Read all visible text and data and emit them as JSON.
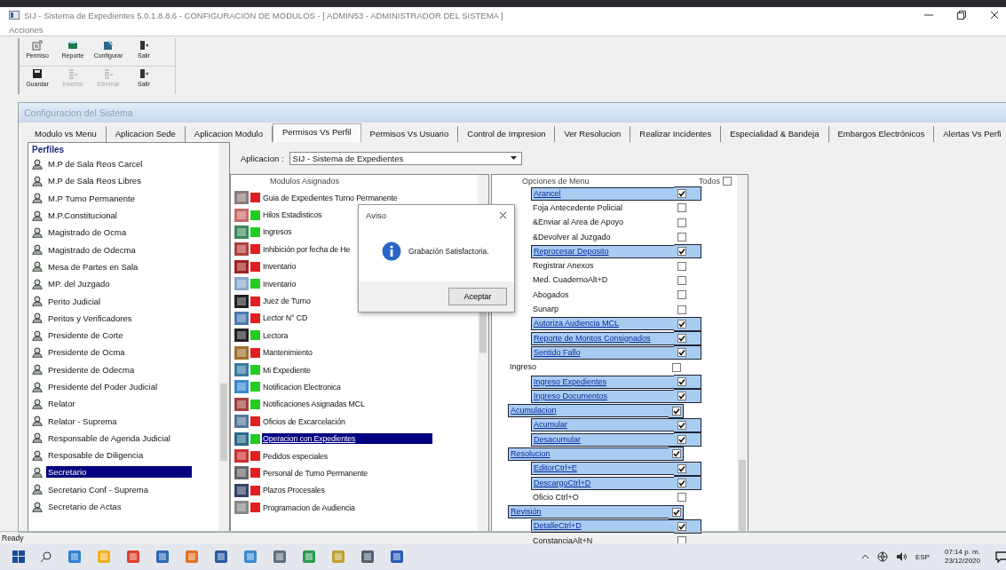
{
  "window": {
    "title": "SIJ - Sistema de Expedientes 5.0.1.8.8.6 - CONFIGURACION DE MODULOS - [ ADMIN53 - ADMINISTRADOR DEL SISTEMA ]"
  },
  "menu": [
    "Acciones"
  ],
  "toolbar_rows": [
    [
      {
        "label": "Permiso",
        "kind": "permiso",
        "disabled": false
      },
      {
        "label": "Reporte",
        "kind": "reporte",
        "disabled": false
      },
      {
        "label": "Configurar",
        "kind": "configurar",
        "disabled": false
      },
      {
        "label": "Salir",
        "kind": "salir",
        "disabled": false
      }
    ],
    [
      {
        "label": "Guardar",
        "kind": "guardar",
        "disabled": false
      },
      {
        "label": "Insertar",
        "kind": "insertar",
        "disabled": true
      },
      {
        "label": "Eliminar",
        "kind": "eliminar",
        "disabled": true
      },
      {
        "label": "Salir",
        "kind": "salir",
        "disabled": false
      }
    ]
  ],
  "child_window": {
    "title": "Configuracion del Sistema"
  },
  "tabs": [
    {
      "label": "Modulo vs Menu",
      "selected": false
    },
    {
      "label": "Aplicacion Sede",
      "selected": false
    },
    {
      "label": "Aplicacion Modulo",
      "selected": false
    },
    {
      "label": "Permisos Vs Perfil",
      "selected": true
    },
    {
      "label": "Permisos Vs Usuario",
      "selected": false
    },
    {
      "label": "Control de Impresion",
      "selected": false
    },
    {
      "label": "Ver Resolucion",
      "selected": false
    },
    {
      "label": "Realizar Incidentes",
      "selected": false
    },
    {
      "label": "Especialidad & Bandeja",
      "selected": false
    },
    {
      "label": "Embargos Electrónicos",
      "selected": false
    },
    {
      "label": "Alertas Vs Perfi",
      "selected": false
    }
  ],
  "profiles": {
    "header": "Perfiles",
    "items": [
      {
        "label": "M.P de Sala Reos Carcel",
        "selected": false
      },
      {
        "label": "M.P de Sala Reos Libres",
        "selected": false
      },
      {
        "label": "M.P Turno Permanente",
        "selected": false
      },
      {
        "label": "M.P.Constitucional",
        "selected": false
      },
      {
        "label": "Magistrado de Ocma",
        "selected": false
      },
      {
        "label": "Magistrado de Odecma",
        "selected": false
      },
      {
        "label": "Mesa de Partes en Sala",
        "selected": false
      },
      {
        "label": "MP. del Juzgado",
        "selected": false
      },
      {
        "label": "Perito Judicial",
        "selected": false
      },
      {
        "label": "Peritos y Verificadores",
        "selected": false
      },
      {
        "label": "Presidente de Corte",
        "selected": false
      },
      {
        "label": "Presidente de Ocma",
        "selected": false
      },
      {
        "label": "Presidente de Odecma",
        "selected": false
      },
      {
        "label": "Presidente del Poder Judicial",
        "selected": false
      },
      {
        "label": "Relator",
        "selected": false
      },
      {
        "label": "Relator - Suprema",
        "selected": false
      },
      {
        "label": "Responsable de Agenda Judicial",
        "selected": false
      },
      {
        "label": "Resposable de Diligencia",
        "selected": false
      },
      {
        "label": "Secretario",
        "selected": true
      },
      {
        "label": "Secretario Conf - Suprema",
        "selected": false
      },
      {
        "label": "Secretario de Actas",
        "selected": false
      }
    ]
  },
  "application": {
    "label": "Aplicacion :",
    "value": "SIJ - Sistema de Expedientes"
  },
  "modules": {
    "header": "Modulos Asignados",
    "items": [
      {
        "label": "Guia de Expedientes Turno Permanente",
        "color": "#e02020",
        "selected": false
      },
      {
        "label": "Hilos Estadisticos",
        "color": "#22cc22",
        "selected": false
      },
      {
        "label": "Ingresos",
        "color": "#22cc22",
        "selected": false
      },
      {
        "label": "Inhibición por fecha de He",
        "color": "#e02020",
        "selected": false
      },
      {
        "label": "Inventario",
        "color": "#e02020",
        "selected": false
      },
      {
        "label": "Inventario",
        "color": "#22cc22",
        "selected": false
      },
      {
        "label": "Juez de Turno",
        "color": "#e02020",
        "selected": false
      },
      {
        "label": "Lector N° CD",
        "color": "#e02020",
        "selected": false
      },
      {
        "label": "Lectora",
        "color": "#22cc22",
        "selected": false
      },
      {
        "label": "Mantenimiento",
        "color": "#e02020",
        "selected": false
      },
      {
        "label": "Mi Expediente",
        "color": "#22cc22",
        "selected": false
      },
      {
        "label": "Notificacion Electronica",
        "color": "#22cc22",
        "selected": false
      },
      {
        "label": "Notificaciones Asignadas MCL",
        "color": "#22cc22",
        "selected": false
      },
      {
        "label": "Oficios de Excarcelación",
        "color": "#e02020",
        "selected": false
      },
      {
        "label": "Operacion con Expedientes",
        "color": "#22cc22",
        "selected": true
      },
      {
        "label": "Pedidos especiales",
        "color": "#e02020",
        "selected": false
      },
      {
        "label": "Personal de Turno Permanente",
        "color": "#e02020",
        "selected": false
      },
      {
        "label": "Plazos Procesales",
        "color": "#e02020",
        "selected": false
      },
      {
        "label": "Programacion de Audiencia",
        "color": "#e02020",
        "selected": false
      }
    ]
  },
  "menu_options": {
    "header": "Opciones de Menu",
    "all_label": "Todos",
    "all_checked": false,
    "items": [
      {
        "children": [
          {
            "label": "Arancel",
            "checked": true
          },
          {
            "label": "Foja Antecedente Policial",
            "checked": false
          },
          {
            "label": "&Enviar al Area de Apoyo",
            "checked": false
          },
          {
            "label": "&Devolver al Juzgado",
            "checked": false
          },
          {
            "label": "Reprocesar Deposito",
            "checked": true
          },
          {
            "label": "Registrar Anexos",
            "checked": false
          },
          {
            "label": "Med. CuadernoAlt+D",
            "checked": false
          },
          {
            "label": "Abogados",
            "checked": false
          },
          {
            "label": "Sunarp",
            "checked": false
          },
          {
            "label": "Autoriza Audiencia MCL",
            "checked": true
          },
          {
            "label": "Reporte de Montos Consignados",
            "checked": true
          },
          {
            "label": "Sentido Fallo",
            "checked": true
          }
        ]
      },
      {
        "label": "Ingreso",
        "checked": false,
        "children": [
          {
            "label": "Ingreso Expedientes",
            "checked": true
          },
          {
            "label": "Ingreso Documentos",
            "checked": true
          }
        ]
      },
      {
        "label": "Acumulacion",
        "checked": true,
        "children": [
          {
            "label": "Acumular",
            "checked": true
          },
          {
            "label": "Desacumular",
            "checked": true
          }
        ]
      },
      {
        "label": "Resolucion",
        "checked": true,
        "children": [
          {
            "label": "EditorCtrl+E",
            "checked": true
          },
          {
            "label": "DescargoCtrl+D",
            "checked": true
          },
          {
            "label": "Oficio Ctrl+O",
            "checked": false
          }
        ]
      },
      {
        "label": "Revisión",
        "checked": true,
        "children": [
          {
            "label": "DetalleCtrl+D",
            "checked": true
          },
          {
            "label": "ConstanciaAlt+N",
            "checked": false
          }
        ]
      }
    ]
  },
  "dialog": {
    "title": "Aviso",
    "message": "Grabación Satisfactoria.",
    "button": "Aceptar"
  },
  "status_bar": "Ready",
  "taskbar": {
    "language": "ESP",
    "time": "07:14 p. m.",
    "date": "23/12/2020"
  }
}
